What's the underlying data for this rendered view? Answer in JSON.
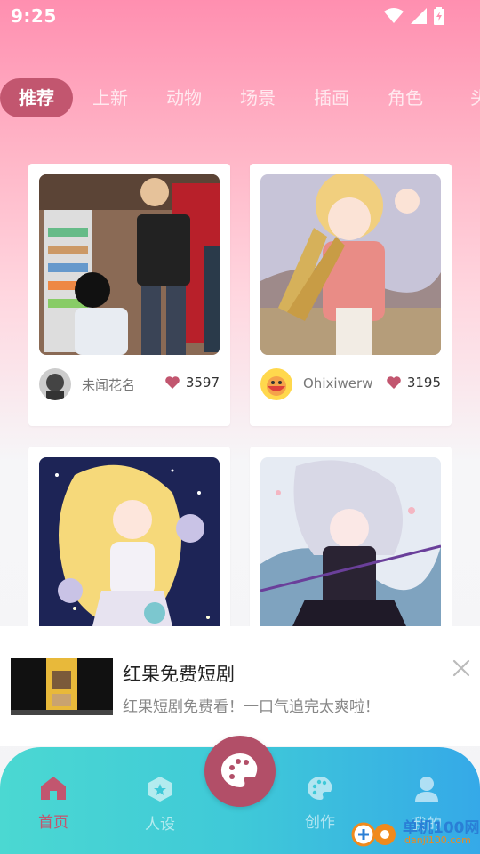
{
  "status_bar": {
    "time": "9:25"
  },
  "tabs": [
    {
      "label": "推荐",
      "active": true
    },
    {
      "label": "上新"
    },
    {
      "label": "动物"
    },
    {
      "label": "场景"
    },
    {
      "label": "插画"
    },
    {
      "label": "角色"
    },
    {
      "label": "头"
    }
  ],
  "feed": [
    {
      "author": "未闻花名",
      "likes": "3597",
      "image": "artwork-boys-convenience-store"
    },
    {
      "author": "Ohixiwerw",
      "likes": "3195",
      "image": "artwork-girl-wheat-field"
    },
    {
      "author": "",
      "likes": "",
      "image": "artwork-blonde-magical-girl"
    },
    {
      "author": "",
      "likes": "",
      "image": "artwork-silver-hair-girl"
    }
  ],
  "ad": {
    "title": "红果免费短剧",
    "description": "红果短剧免费看！一口气追完太爽啦！"
  },
  "bottom_nav": [
    {
      "label": "首页",
      "icon": "home-icon",
      "active": true
    },
    {
      "label": "人设",
      "icon": "character-icon"
    },
    {
      "label": "创作",
      "icon": "palette-icon"
    },
    {
      "label": "我的",
      "icon": "profile-icon"
    }
  ],
  "watermark": {
    "brand": "单机100网",
    "url": "danji100.com"
  },
  "colors": {
    "accent": "#c2566f",
    "nav_gradient_start": "#4bd8d2",
    "nav_gradient_end": "#35a9e8",
    "header_pink": "#ff8fb0",
    "heart": "#c2566f"
  }
}
